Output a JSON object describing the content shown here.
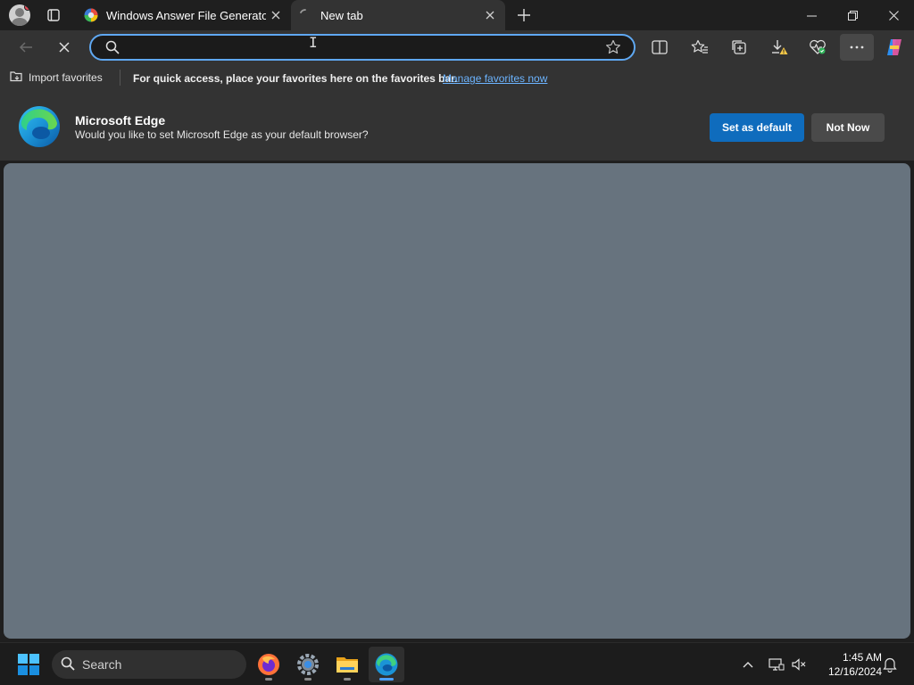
{
  "browser": {
    "tabs": [
      {
        "label": "Windows Answer File Generator",
        "active": false
      },
      {
        "label": "New tab",
        "active": true
      }
    ],
    "address_placeholder": "",
    "address_value": ""
  },
  "favorites_bar": {
    "import_label": "Import favorites",
    "message": "For quick access, place your favorites here on the favorites bar.",
    "manage_link": "Manage favorites now"
  },
  "default_banner": {
    "title": "Microsoft Edge",
    "text": "Would you like to set Microsoft Edge as your default browser?",
    "primary_button": "Set as default",
    "secondary_button": "Not Now"
  },
  "taskbar": {
    "search_label": "Search",
    "apps": [
      "firefox-icon",
      "settings-icon",
      "file-explorer-icon",
      "edge-icon"
    ],
    "time": "1:45 AM",
    "date": "12/16/2024"
  },
  "colors": {
    "accent": "#0f6cbd",
    "link": "#6cb4ff",
    "focus_ring": "#5fa8f2",
    "content_bg": "#67737e"
  }
}
